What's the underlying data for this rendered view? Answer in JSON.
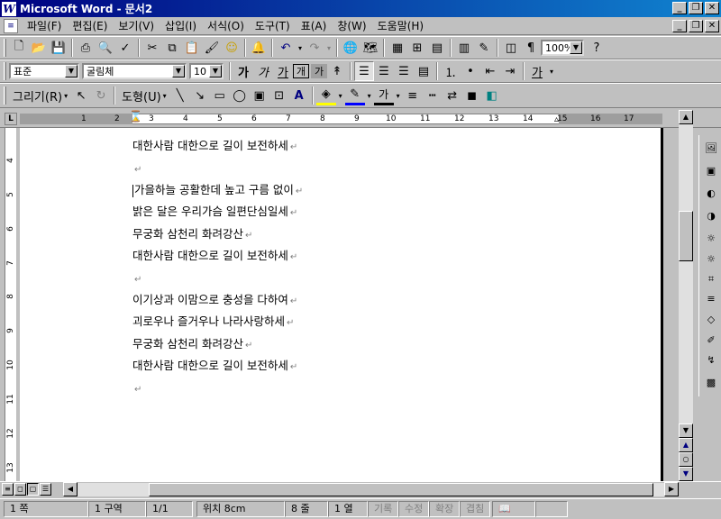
{
  "window": {
    "title": "Microsoft Word - 문서2",
    "app_icon": "W"
  },
  "menu": [
    "파일(F)",
    "편집(E)",
    "보기(V)",
    "삽입(I)",
    "서식(O)",
    "도구(T)",
    "표(A)",
    "창(W)",
    "도움말(H)"
  ],
  "standard_toolbar": {
    "zoom": "100%"
  },
  "format_toolbar": {
    "style": "표준",
    "font": "굴림체",
    "size": "10",
    "bold": "가",
    "italic": "가",
    "underline": "가",
    "char_border": "개",
    "char_shade": "가",
    "font_color": "가"
  },
  "drawing_toolbar": {
    "draw_label": "그리기(R)",
    "shapes_label": "도형(U)"
  },
  "ruler": {
    "h_numbers": [
      "1",
      "2",
      "3",
      "4",
      "5",
      "6",
      "7",
      "8",
      "9",
      "10",
      "11",
      "12",
      "13",
      "14",
      "15",
      "16",
      "17"
    ],
    "v_numbers": [
      "4",
      "5",
      "6",
      "7",
      "8",
      "9",
      "10",
      "11",
      "12",
      "13"
    ]
  },
  "document": {
    "lines": [
      "대한사람 대한으로 길이 보전하세",
      "",
      "가을하늘 공활한데 높고 구름 없이",
      "밝은 달은 우리가슴 일편단심일세",
      "무궁화 삼천리 화려강산",
      "대한사람 대한으로 길이 보전하세",
      "",
      "이기상과 이맘으로 충성을 다하여",
      "괴로우나 즐거우나 나라사랑하세",
      "무궁화 삼천리 화려강산",
      "대한사람 대한으로 길이 보전하세",
      ""
    ],
    "pilcrow": "↵"
  },
  "status": {
    "page": "1 쪽",
    "section": "1 구역",
    "pages": "1/1",
    "position": "위치 8cm",
    "line": "8 줄",
    "col": "1 열",
    "rec": "기록",
    "trk": "수정",
    "ext": "확장",
    "ovr": "겹침"
  }
}
